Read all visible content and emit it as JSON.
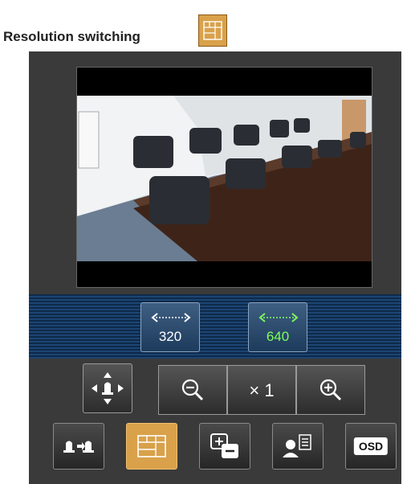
{
  "header": {
    "title": "Resolution switching",
    "icon": "resolution-switching-icon",
    "icon_color": "#d9a14a"
  },
  "viewer": {
    "image": "conference-room-camera-view"
  },
  "resolution": {
    "options": [
      {
        "label": "320",
        "color": "#ffffff"
      },
      {
        "label": "640",
        "color": "#7dff5a",
        "selected": true
      }
    ]
  },
  "controls": {
    "pan_tilt": "pan-tilt-icon",
    "zoom_out": "zoom-out-icon",
    "zoom_value": "× 1",
    "zoom_in": "zoom-in-icon"
  },
  "toolbar": {
    "items": [
      {
        "icon": "preset-position-icon"
      },
      {
        "icon": "resolution-switching-icon",
        "active": true
      },
      {
        "icon": "brightness-icon"
      },
      {
        "icon": "user-management-icon"
      },
      {
        "icon": "osd-icon",
        "label": "OSD"
      }
    ]
  }
}
